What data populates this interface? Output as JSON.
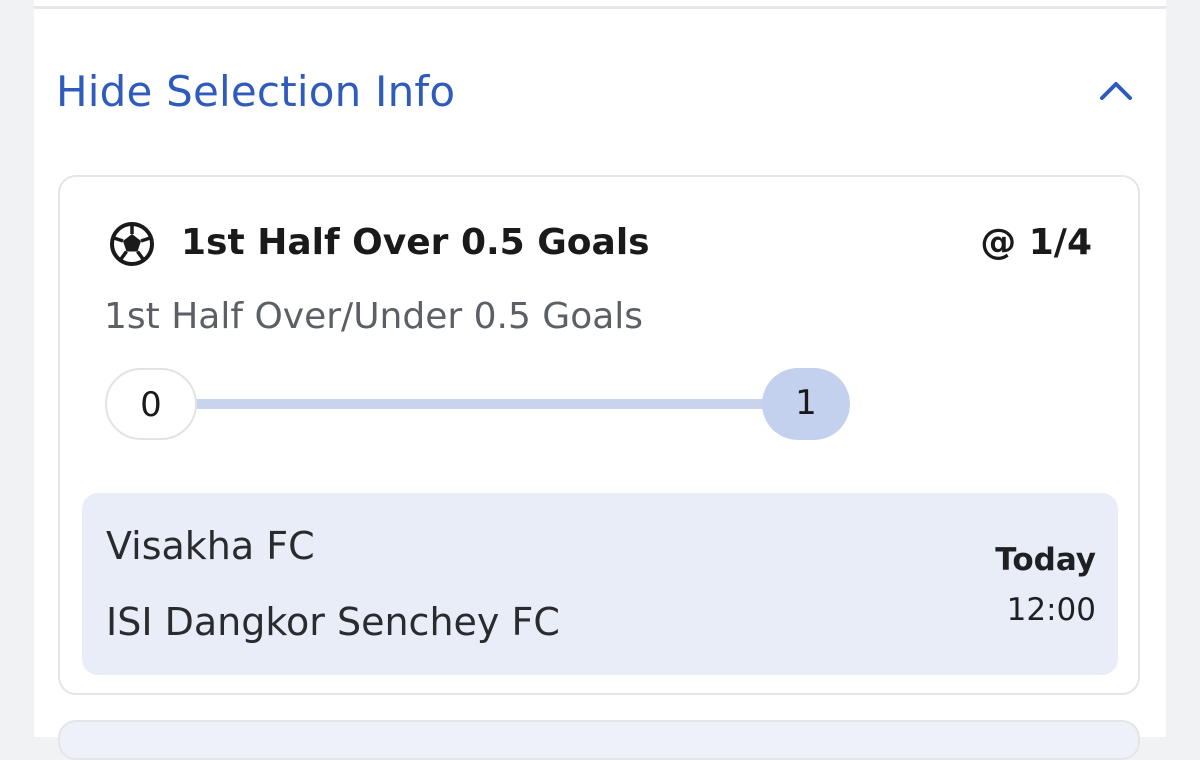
{
  "selection_info": {
    "toggle_label": "Hide Selection Info",
    "toggle_icon": "chevron-up-icon",
    "accent_color": "#2f5bbd"
  },
  "selection": {
    "sport_icon": "football-icon",
    "name": "1st Half Over 0.5 Goals",
    "odds": "@ 1/4",
    "market": "1st Half Over/Under 0.5 Goals",
    "progress": {
      "start_label": "0",
      "end_label": "1",
      "fraction": 1.0,
      "track_color": "#c8d3ee"
    },
    "event": {
      "home_team": "Visakha FC",
      "away_team": "ISI Dangkor Senchey FC",
      "day": "Today",
      "time": "12:00",
      "background_color": "#e8edf8"
    }
  }
}
